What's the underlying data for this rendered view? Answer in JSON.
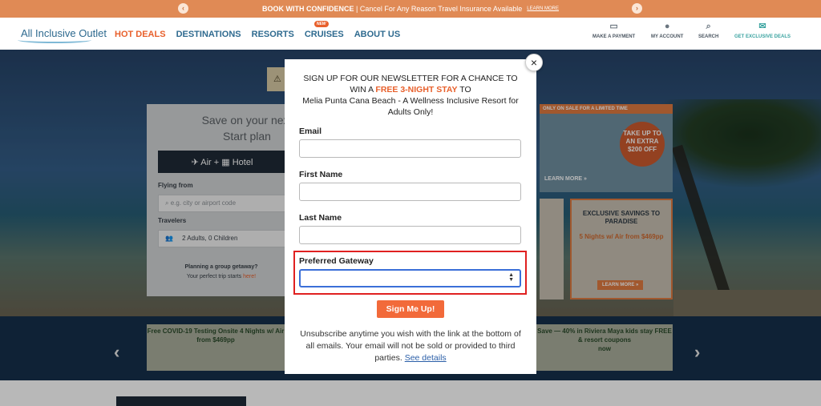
{
  "promo_bar": {
    "bold_text": "BOOK WITH CONFIDENCE",
    "text": " | Cancel For Any Reason Travel Insurance Available",
    "link": "LEARN MORE",
    "prev_icon": "chevron-left-icon",
    "next_icon": "chevron-right-icon"
  },
  "header": {
    "logo": "All Inclusive Outlet",
    "nav": [
      "HOT DEALS",
      "DESTINATIONS",
      "RESORTS",
      "CRUISES",
      "ABOUT US"
    ],
    "cruises_badge": "NEW",
    "utility": [
      {
        "label": "MAKE A PAYMENT",
        "icon": "credit-card-icon"
      },
      {
        "label": "MY ACCOUNT",
        "icon": "user-icon"
      },
      {
        "label": "SEARCH",
        "icon": "search-icon"
      },
      {
        "label": "GET EXCLUSIVE DEALS",
        "icon": "envelope-icon"
      }
    ]
  },
  "background": {
    "search_title": "Save on your next... Start plan...",
    "search_title_l1": "Save on your next",
    "search_title_l2": "Start plan",
    "air_hotel": "✈ Air + ▦ Hotel",
    "flying_from_label": "Flying from",
    "flying_from_placeholder": "e.g. city or airport code",
    "travelers_label": "Travelers",
    "travelers_value": "2 Adults,  0 Children",
    "group_q": "Planning a group getaway?",
    "group_sub": "Your perfect trip starts ",
    "group_here": "here!",
    "promo_band": "ONLY ON SALE FOR A LIMITED TIME",
    "promo_circle": "TAKE UP TO AN EXTRA $200 OFF",
    "promo_learn": "LEARN MORE »",
    "savings_title": "EXCLUSIVE SAVINGS TO PARADISE",
    "savings_sub": "5 Nights w/ Air from $469pp",
    "savings_learn": "LEARN MORE »",
    "slide_a": "Free COVID-19 Testing Onsite 4 Nights w/ Air from $469pp",
    "slide_b": "Save — 40% in Riviera Maya kids stay FREE & resort coupons",
    "slide_b_brand": "now"
  },
  "modal": {
    "heading_l1": "SIGN UP FOR OUR NEWSLETTER FOR A CHANCE TO",
    "heading_l2_a": "WIN A ",
    "heading_l2_hl": "FREE 3-NIGHT STAY",
    "heading_l2_b": " TO",
    "heading_l3": "Melia Punta Cana Beach - A Wellness Inclusive Resort for",
    "heading_l4": "Adults Only!",
    "email_label": "Email",
    "first_name_label": "First Name",
    "last_name_label": "Last Name",
    "gateway_label": "Preferred Gateway",
    "gateway_value": "",
    "submit_label": "Sign Me Up!",
    "fine_print": "Unsubscribe anytime you wish with the link at the bottom of all emails. Your email will not be sold or provided to third parties. ",
    "fine_link": "See details",
    "close_label": "×"
  },
  "colors": {
    "accent_orange": "#f26a3a",
    "brand_blue": "#2e6a8f",
    "highlight_red": "#e02020"
  }
}
